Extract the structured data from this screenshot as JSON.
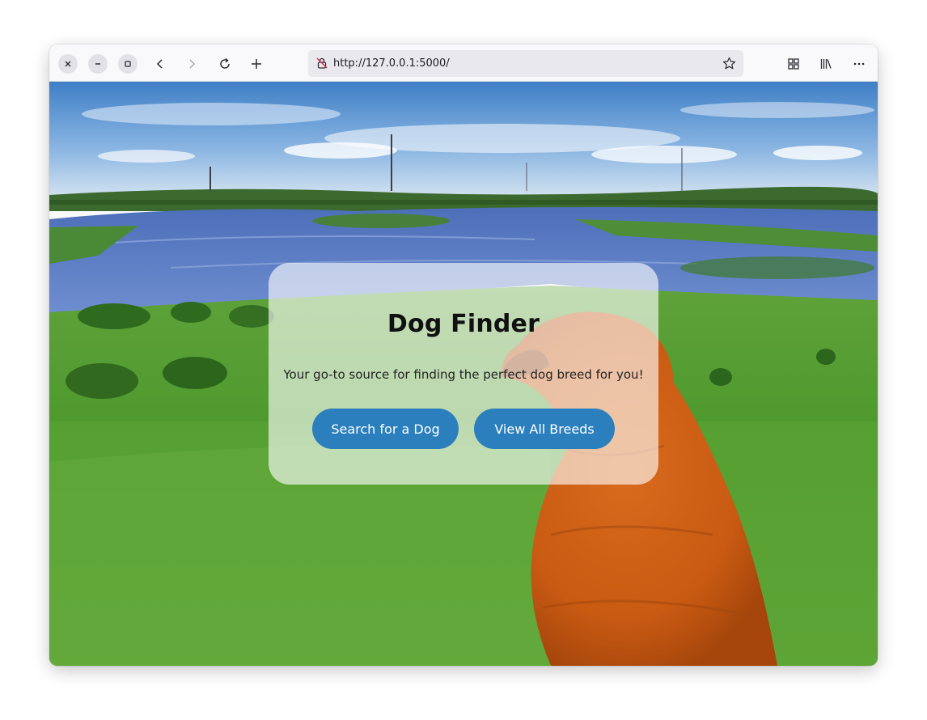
{
  "browser": {
    "url": "http://127.0.0.1:5000/",
    "icons": {
      "close": "close-icon",
      "minimize": "minimize-icon",
      "maximize": "maximize-icon",
      "back": "back-arrow-icon",
      "forward": "forward-arrow-icon",
      "reload": "reload-icon",
      "new_tab": "plus-icon",
      "site_info": "not-secure-lock-icon",
      "bookmark": "star-icon",
      "tabs_overview": "grid-icon",
      "library": "library-icon",
      "menu": "more-icon"
    }
  },
  "hero": {
    "title": "Dog Finder",
    "subtitle": "Your go-to source for finding the perfect dog breed for you!",
    "buttons": {
      "search": "Search for a Dog",
      "breeds": "View All Breeds"
    }
  },
  "colors": {
    "button_bg": "#2b7fbd",
    "button_text": "#ffffff",
    "card_bg": "rgba(255,255,255,0.62)"
  }
}
